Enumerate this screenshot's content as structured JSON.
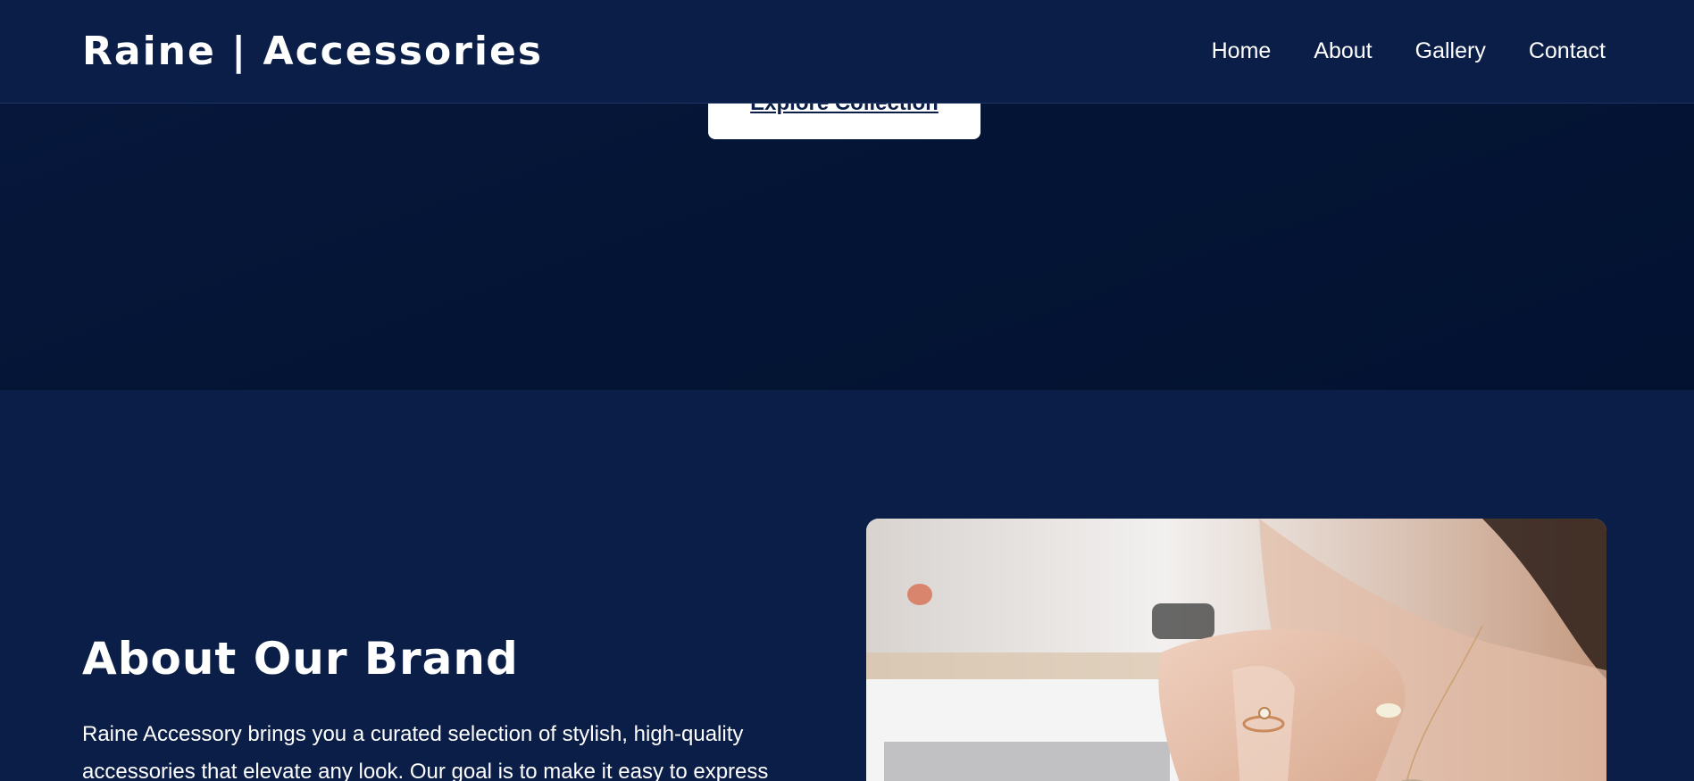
{
  "header": {
    "logo": "Raine | Accessories",
    "nav": [
      "Home",
      "About",
      "Gallery",
      "Contact"
    ]
  },
  "hero": {
    "cta_label": "Explore Collection"
  },
  "about": {
    "title": "About Our Brand",
    "text": "Raine Accessory brings you a curated selection of stylish, high-quality accessories that elevate any look. Our goal is to make it easy to express"
  },
  "colors": {
    "background": "#0b1e47",
    "hero": "#041434",
    "button": "#ffffff",
    "text": "#ffffff"
  }
}
